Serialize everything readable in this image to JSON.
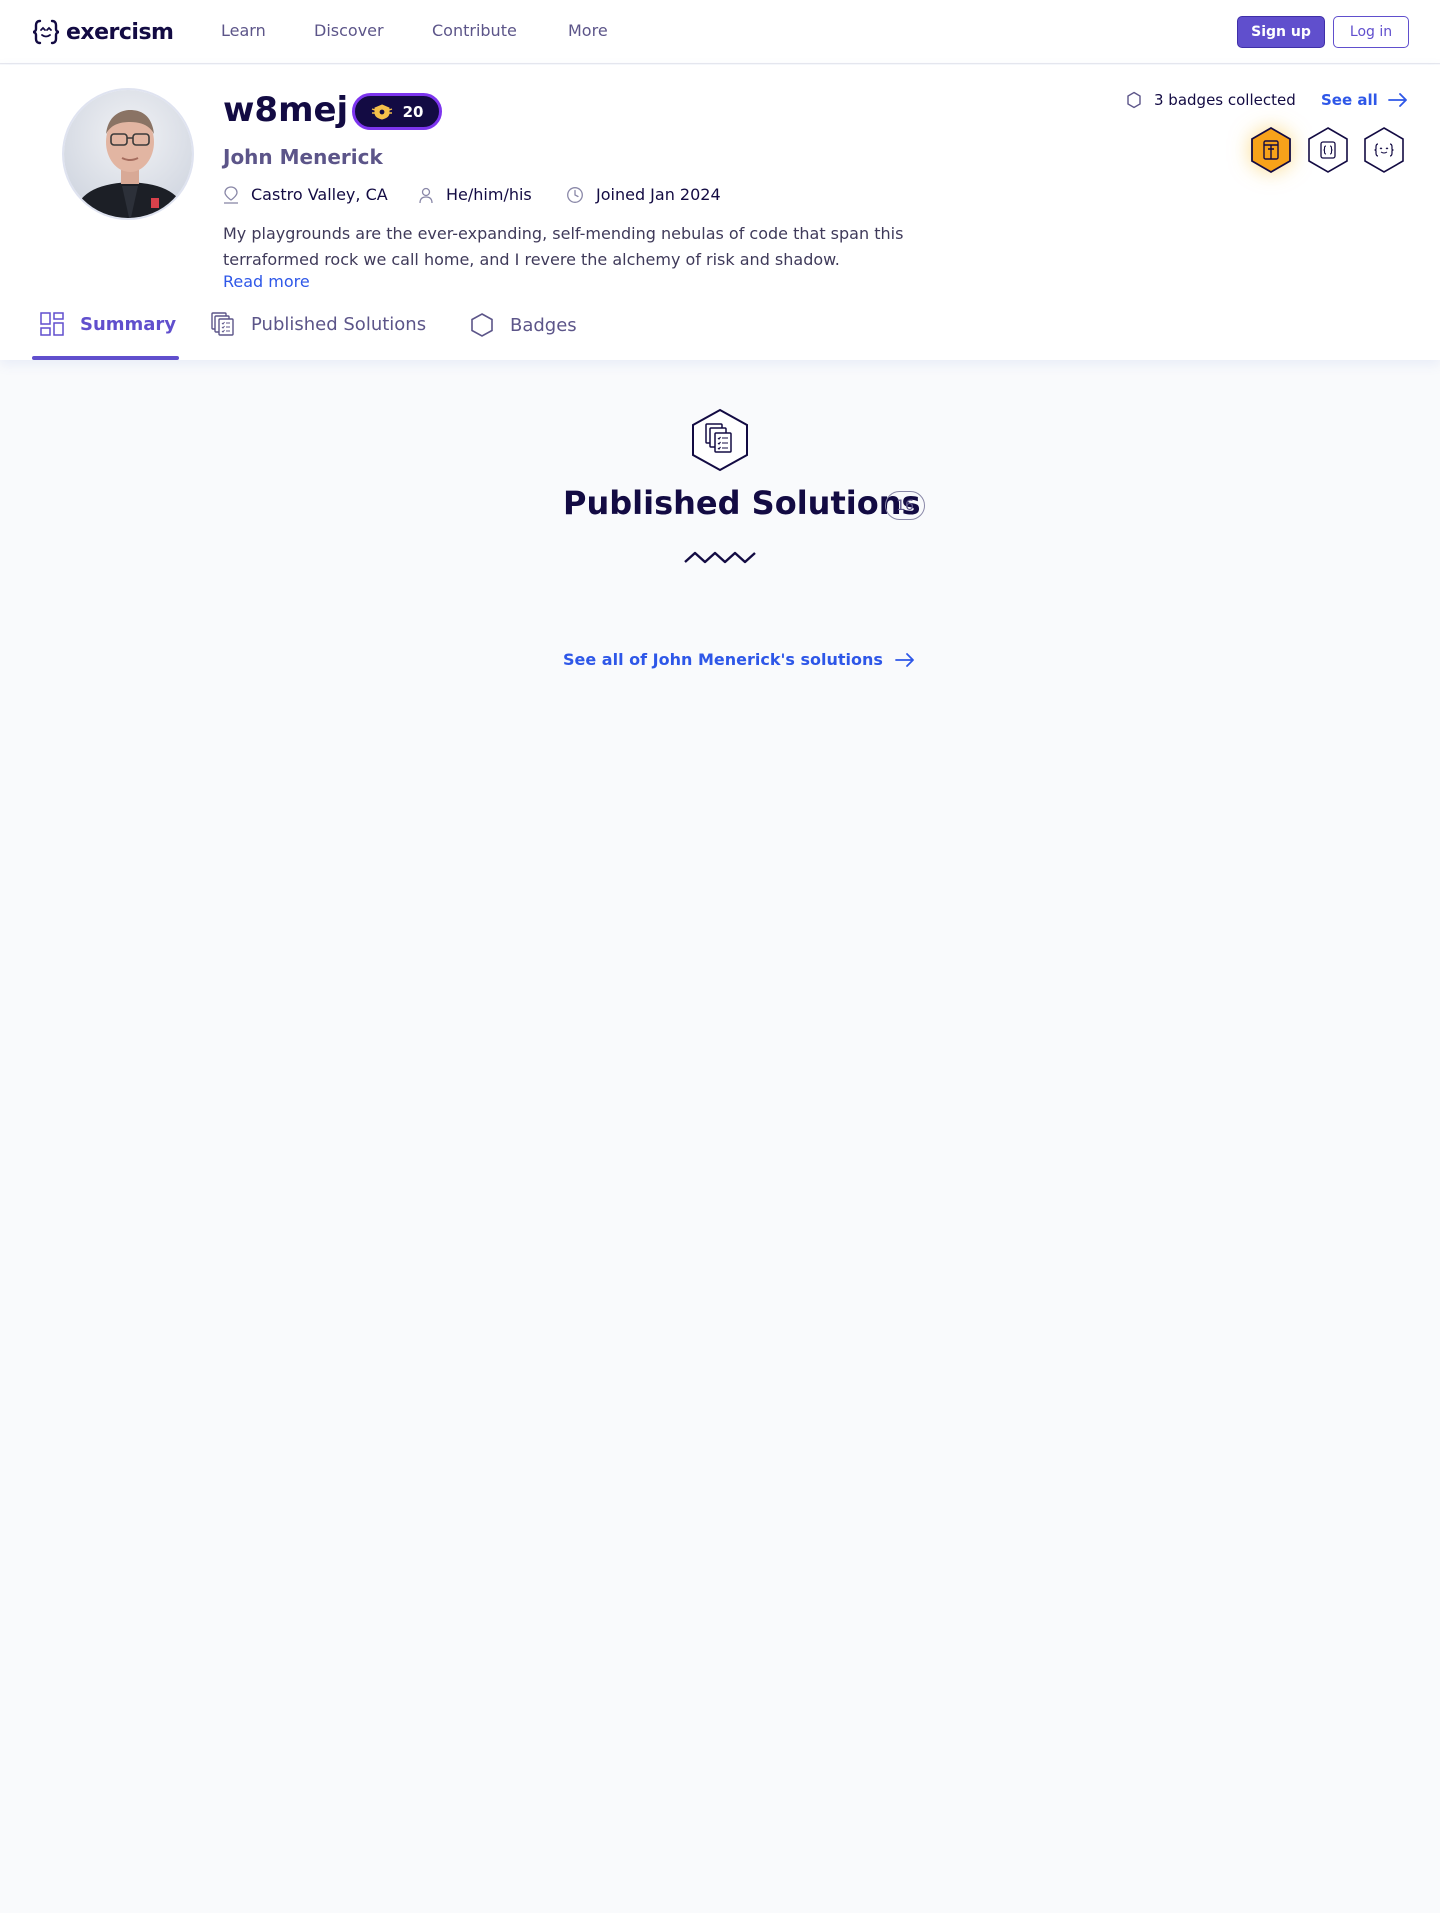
{
  "nav": {
    "logo_text": "exercism",
    "items": [
      "Learn",
      "Discover",
      "Contribute",
      "More"
    ],
    "signup_label": "Sign up",
    "login_label": "Log in"
  },
  "profile": {
    "handle": "w8mej",
    "reputation": "20",
    "name": "John Menerick",
    "location": "Castro Valley, CA",
    "pronouns": "He/him/his",
    "joined": "Joined Jan 2024",
    "bio": "My playgrounds are the ever-expanding, self-mending nebulas of code that span this terraformed rock we call home, and I revere the alchemy of risk and shadow.",
    "read_more": "Read more"
  },
  "badges": {
    "collected_label": "3 badges collected",
    "see_all_label": "See all",
    "items": [
      {
        "icon": "rare-badge-icon",
        "color": "#f7a21a"
      },
      {
        "icon": "curly-braces-badge-icon",
        "color": "#ffffff"
      },
      {
        "icon": "exercism-logo-badge-icon",
        "color": "#ffffff"
      }
    ]
  },
  "tabs": [
    {
      "label": "Summary",
      "active": true,
      "icon": "summary-icon"
    },
    {
      "label": "Published Solutions",
      "active": false,
      "icon": "solutions-icon"
    },
    {
      "label": "Badges",
      "active": false,
      "icon": "badge-hex-icon"
    }
  ],
  "solutions_section": {
    "title": "Published Solutions",
    "count": "16",
    "see_all_label": "See all of John Menerick's solutions"
  },
  "colors": {
    "accent": "#604fcd",
    "link": "#2e57e8",
    "dark": "#130b43",
    "reputation_border": "#7d35ef",
    "badge_gold": "#f7a21a"
  }
}
